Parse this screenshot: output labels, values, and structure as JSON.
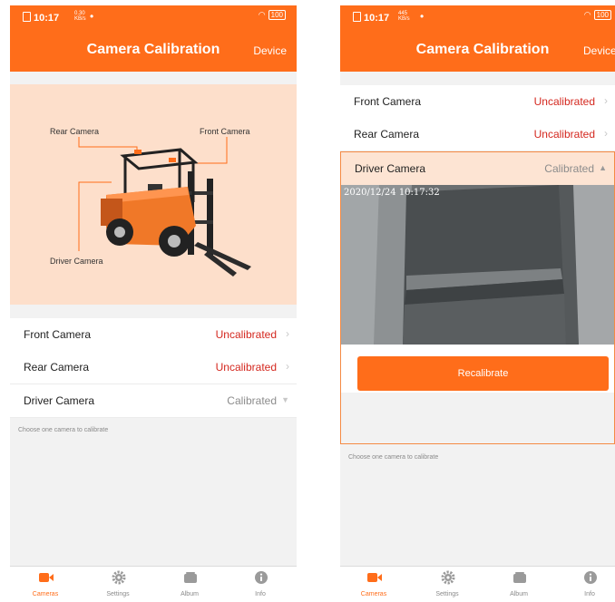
{
  "status": {
    "time": "10:17",
    "battery": "100",
    "net1": [
      "0.30",
      "KB/s"
    ],
    "net2": [
      "445",
      "KB/s"
    ]
  },
  "header": {
    "title": "Camera Calibration",
    "device": "Device"
  },
  "illustration": {
    "rear": "Rear Camera",
    "front": "Front Camera",
    "driver": "Driver Camera"
  },
  "cameras": [
    {
      "name": "Front Camera",
      "status": "Uncalibrated"
    },
    {
      "name": "Rear Camera",
      "status": "Uncalibrated"
    },
    {
      "name": "Driver Camera",
      "status": "Calibrated"
    }
  ],
  "hint": "Choose one camera to calibrate",
  "preview": {
    "timestamp": "2020/12/24 10:17:32"
  },
  "recalibrate": "Recalibrate",
  "tabs": [
    {
      "label": "Cameras",
      "icon": "video-camera-icon",
      "active": true
    },
    {
      "label": "Settings",
      "icon": "gear-icon",
      "active": false
    },
    {
      "label": "Album",
      "icon": "album-icon",
      "active": false
    },
    {
      "label": "Info",
      "icon": "info-icon",
      "active": false
    }
  ],
  "colors": {
    "accent": "#ff6d1a",
    "uncalibrated": "#d4281f",
    "calibrated": "#8c8c8c",
    "illustration_bg": "#fddfcb"
  }
}
